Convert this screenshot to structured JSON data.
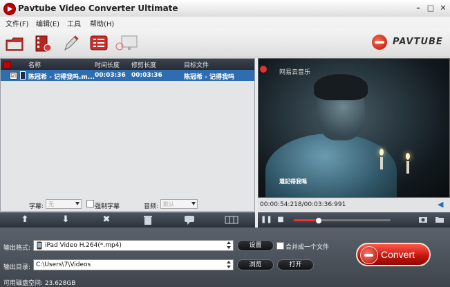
{
  "window": {
    "title": "Pavtube Video Converter Ultimate",
    "controls": [
      "–",
      "□",
      "✕"
    ]
  },
  "menu": [
    "文件(F)",
    "编辑(E)",
    "工具",
    "帮助(H)"
  ],
  "toolbar": {
    "buttons": [
      "add-video-icon",
      "add-folder-icon",
      "edit-icon",
      "merge-list-icon",
      "display-icon"
    ]
  },
  "brand": {
    "logo_text": "PAVTUBE",
    "accent": "#d9261c"
  },
  "file_list": {
    "headers": {
      "name": "名称",
      "duration": "时间长度",
      "trimmed": "修剪长度",
      "target": "目标文件"
    },
    "rows": [
      {
        "checked": "☑",
        "name": "陈冠希 - 记得我吗.m...",
        "duration": "00:03:36",
        "trimmed": "00:03:36",
        "target": "陈冠希 - 记得我吗"
      }
    ]
  },
  "subtitle_row": {
    "subtitle_label": "字幕:",
    "subtitle_value": "无",
    "force_label": "强制字幕",
    "audio_label": "音频:",
    "audio_value": "默认"
  },
  "actions": [
    "move-up-icon",
    "move-down-icon",
    "remove-icon",
    "delete-icon",
    "comment-icon",
    "split-icon"
  ],
  "preview": {
    "watermark": "网易云音乐",
    "subtitle": "還記得我嗎",
    "timecode": "00:00:54:218/00:03:36:991",
    "progress": 0.25
  },
  "output": {
    "format_label": "输出格式:",
    "format_value": "iPad Video H.264(*.mp4)",
    "settings_button": "设置",
    "merge_label": "合并成一个文件",
    "dir_label": "输出目录:",
    "dir_value": "C:\\Users\\7\\Videos",
    "browse_button": "浏览",
    "open_button": "打开",
    "convert_button": "Convert",
    "disk_space": "可用磁盘空间: 23.628GB"
  }
}
